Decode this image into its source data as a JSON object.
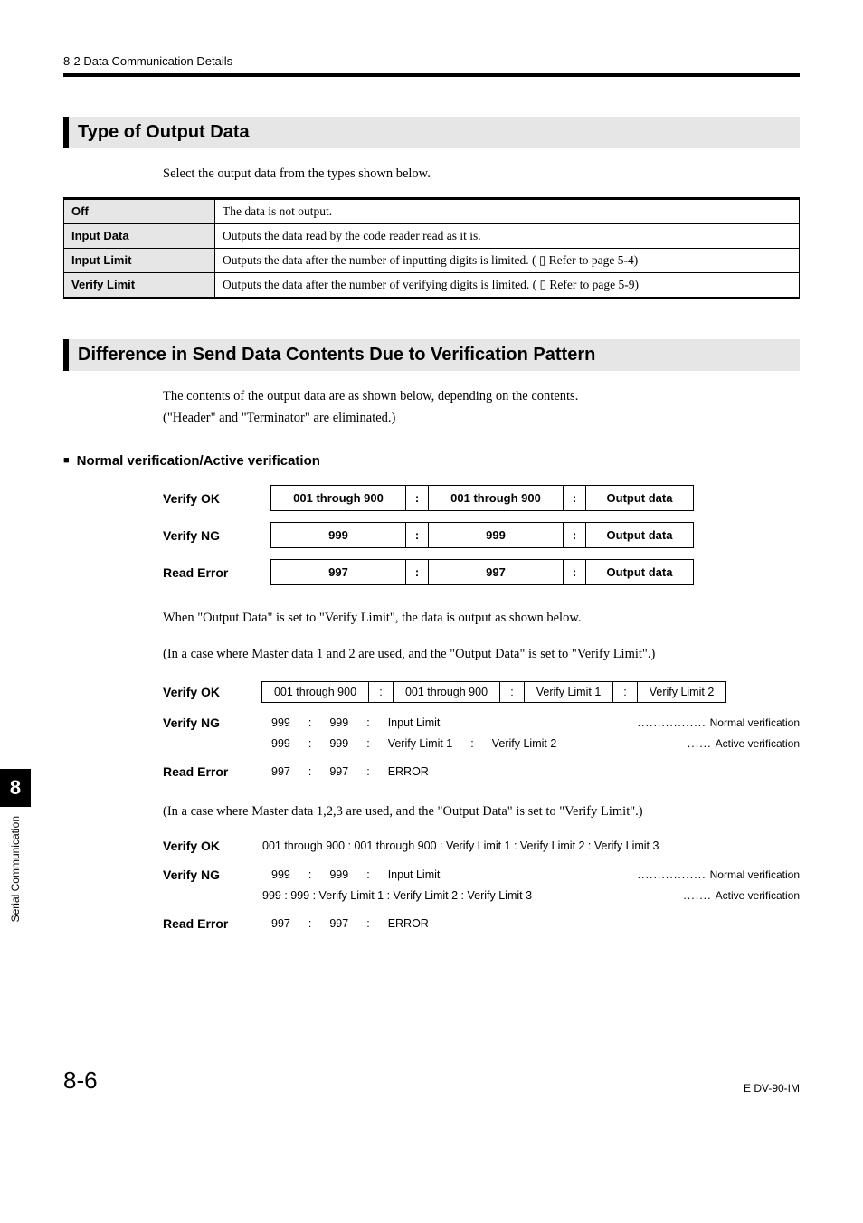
{
  "header": {
    "crumb": "8-2  Data Communication Details"
  },
  "section1": {
    "title": "Type of Output Data",
    "lead": "Select the output data from the types shown below.",
    "rows": [
      {
        "label": "Off",
        "desc_full": "The data is not output."
      },
      {
        "label": "Input Data",
        "desc_full": "Outputs the data read by the code reader read as it is."
      },
      {
        "label": "Input Limit",
        "desc": "Outputs the data after the number of inputting digits is limited. (",
        "ref": " Refer to page 5-4)"
      },
      {
        "label": "Verify Limit",
        "desc": "Outputs the data after the number of verifying digits is limited. (",
        "ref": " Refer to page 5-9)"
      }
    ]
  },
  "section2": {
    "title": "Difference in Send Data Contents Due to Verification Pattern",
    "lead1": "The contents of the output data are as shown below, depending on the contents.",
    "lead2": "(\"Header\" and \"Terminator\" are eliminated.)",
    "sub": "Normal verification/Active verification",
    "matrix": [
      {
        "label": "Verify OK",
        "c1": "001 through 900",
        "c2": "001 through 900",
        "out": "Output data"
      },
      {
        "label": "Verify NG",
        "c1": "999",
        "c2": "999",
        "out": "Output data"
      },
      {
        "label": "Read Error",
        "c1": "997",
        "c2": "997",
        "out": "Output data"
      }
    ],
    "sep": ":",
    "note_a": "When \"Output Data\" is set to \"Verify Limit\", the data is output as shown below.",
    "noteB": "(In a case where Master data 1 and 2 are used, and the \"Output Data\" is set to \"Verify Limit\".)",
    "vl2": {
      "ok": {
        "label": "Verify OK",
        "c1": "001 through 900",
        "c2": "001 through 900",
        "c3": "Verify Limit 1",
        "c4": "Verify Limit 2"
      },
      "ng": {
        "label": "Verify NG",
        "line1": {
          "a": "999",
          "b": "999",
          "c": "Input Limit",
          "note": "Normal verification"
        },
        "line2": {
          "a": "999",
          "b": "999",
          "c": "Verify Limit 1",
          "d": "Verify Limit 2",
          "note": "Active verification"
        }
      },
      "re": {
        "label": "Read Error",
        "a": "997",
        "b": "997",
        "c": "ERROR"
      }
    },
    "noteC": "(In a case where Master data 1,2,3 are used, and the \"Output Data\" is set to \"Verify Limit\".)",
    "vl3": {
      "ok": {
        "label": "Verify OK",
        "text": "001 through 900  :  001 through 900  :  Verify Limit 1  :  Verify Limit 2  :  Verify Limit 3"
      },
      "ng": {
        "label": "Verify NG",
        "line1": {
          "a": "999",
          "b": "999",
          "c": "Input Limit",
          "note": "Normal verification"
        },
        "line2": {
          "text": "999   :   999   :  Verify Limit 1  :  Verify Limit 2  :  Verify Limit 3",
          "note": "Active verification"
        }
      },
      "re": {
        "label": "Read Error",
        "a": "997",
        "b": "997",
        "c": "ERROR"
      }
    }
  },
  "sidetab": {
    "num": "8",
    "label": "Serial Communication"
  },
  "footer": {
    "page": "8-6",
    "doc": "E DV-90-IM"
  },
  "glyph": {
    "sep": ":",
    "book": "▯",
    "dots": "................."
  }
}
